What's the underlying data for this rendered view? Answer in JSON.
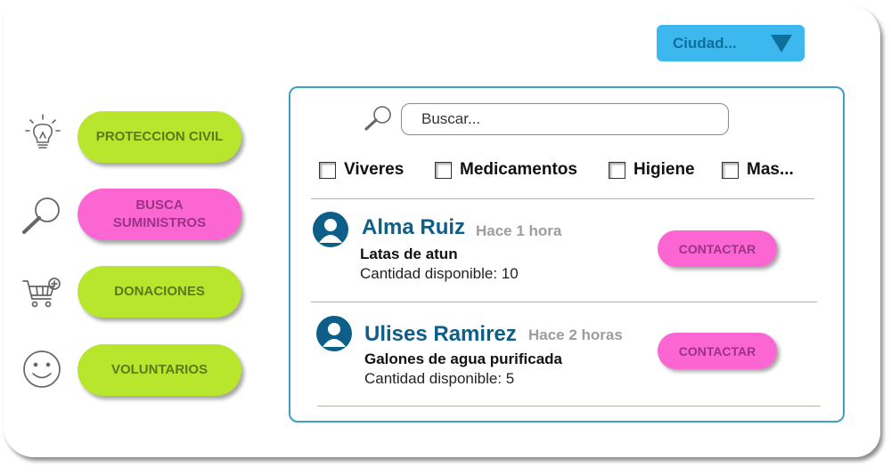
{
  "city_dropdown": {
    "selected": "Ciudad..."
  },
  "sidebar": {
    "items": [
      {
        "label": "PROTECCION CIVIL",
        "icon": "lightbulb-icon",
        "color": "#b8e62d"
      },
      {
        "label": "BUSCA SUMINISTROS",
        "icon": "magnifier-icon",
        "color": "#fb66d3"
      },
      {
        "label": "DONACIONES",
        "icon": "cart-icon",
        "color": "#b8e62d"
      },
      {
        "label": "VOLUNTARIOS",
        "icon": "smiley-icon",
        "color": "#b8e62d"
      }
    ]
  },
  "search": {
    "placeholder": "Buscar...",
    "icon": "search-icon"
  },
  "filters": [
    {
      "label": "Viveres",
      "checked": false
    },
    {
      "label": "Medicamentos",
      "checked": false
    },
    {
      "label": "Higiene",
      "checked": false
    },
    {
      "label": "Mas...",
      "checked": false
    }
  ],
  "posts": [
    {
      "name": "Alma Ruiz",
      "time": "Hace 1 hora",
      "item": "Latas de atun",
      "quantity": "Cantidad disponible: 10",
      "action": "CONTACTAR"
    },
    {
      "name": "Ulises Ramirez",
      "time": "Hace 2 horas",
      "item": "Galones de agua purificada",
      "quantity": "Cantidad disponible: 5",
      "action": "CONTACTAR"
    }
  ],
  "colors": {
    "accent_blue": "#3db8ef",
    "panel_border": "#3ea0c0",
    "green_button": "#b8e62d",
    "pink_button": "#fb66d3",
    "name_blue": "#0e5e86"
  }
}
